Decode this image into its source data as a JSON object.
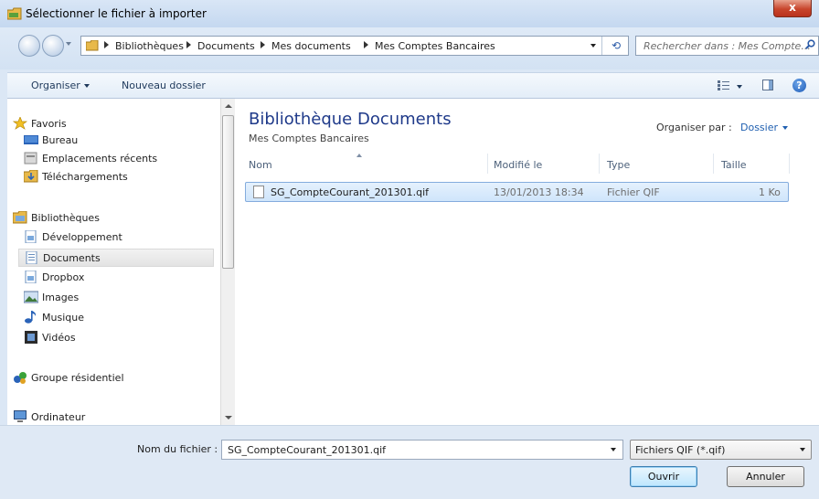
{
  "window": {
    "title": "Sélectionner le fichier à importer",
    "close_label": "x"
  },
  "address": {
    "breadcrumbs": [
      "Bibliothèques",
      "Documents",
      "Mes documents",
      "Mes Comptes Bancaires"
    ],
    "refresh_glyph": "⟲"
  },
  "search": {
    "placeholder": "Rechercher dans : Mes Compte..."
  },
  "toolbar": {
    "organize_label": "Organiser",
    "new_folder_label": "Nouveau dossier",
    "help_label": "?"
  },
  "sidebar": {
    "items": [
      {
        "label": "Favoris",
        "icon": "star-icon"
      },
      {
        "label": "Bureau",
        "icon": "desktop-icon"
      },
      {
        "label": "Emplacements récents",
        "icon": "recent-places-icon"
      },
      {
        "label": "Téléchargements",
        "icon": "downloads-icon"
      },
      {
        "label": "Bibliothèques",
        "icon": "libraries-icon"
      },
      {
        "label": "Développement",
        "icon": "library-icon"
      },
      {
        "label": "Documents",
        "icon": "documents-icon",
        "selected": true
      },
      {
        "label": "Dropbox",
        "icon": "library-icon"
      },
      {
        "label": "Images",
        "icon": "pictures-icon"
      },
      {
        "label": "Musique",
        "icon": "music-icon"
      },
      {
        "label": "Vidéos",
        "icon": "videos-icon"
      },
      {
        "label": "Groupe résidentiel",
        "icon": "homegroup-icon"
      },
      {
        "label": "Ordinateur",
        "icon": "computer-icon"
      }
    ]
  },
  "main": {
    "title": "Bibliothèque Documents",
    "subtitle": "Mes Comptes Bancaires",
    "arrange_label": "Organiser par :",
    "arrange_value": "Dossier",
    "columns": [
      "Nom",
      "Modifié le",
      "Type",
      "Taille"
    ],
    "files": [
      {
        "name": "SG_CompteCourant_201301.qif",
        "modified": "13/01/2013 18:34",
        "type": "Fichier QIF",
        "size": "1 Ko"
      }
    ]
  },
  "footer": {
    "filename_label": "Nom du fichier :",
    "filename_value": "SG_CompteCourant_201301.qif",
    "filter_value": "Fichiers QIF (*.qif)",
    "open_label": "Ouvrir",
    "cancel_label": "Annuler"
  },
  "colors": {
    "accent": "#1f3a8a",
    "selection": "#cfe5fb",
    "chrome": "#dbe7f5"
  }
}
